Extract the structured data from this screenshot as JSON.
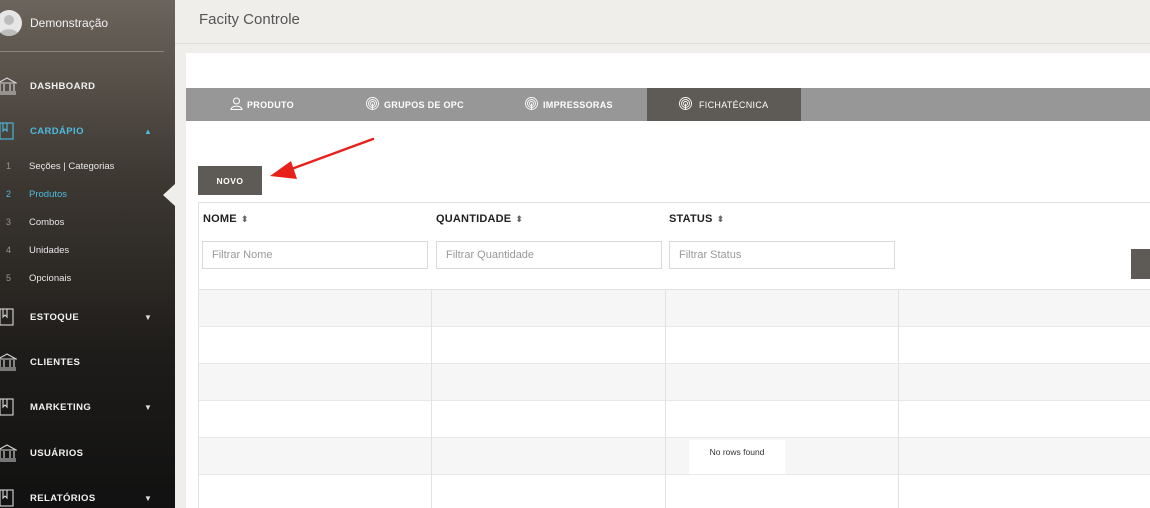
{
  "user": {
    "name": "Demonstração"
  },
  "header": {
    "title": "Facity Controle"
  },
  "sidebar": {
    "items": [
      {
        "label": "DASHBOARD",
        "icon": "bank-icon"
      },
      {
        "label": "CARDÁPIO",
        "icon": "book-icon",
        "caret": "▲"
      },
      {
        "label": "ESTOQUE",
        "icon": "book-icon",
        "caret": "▼"
      },
      {
        "label": "CLIENTES",
        "icon": "bank-icon"
      },
      {
        "label": "MARKETING",
        "icon": "book-icon",
        "caret": "▼"
      },
      {
        "label": "USUÁRIOS",
        "icon": "bank-icon"
      },
      {
        "label": "RELATÓRIOS",
        "icon": "book-icon",
        "caret": "▼"
      }
    ],
    "subitems": [
      {
        "num": "1",
        "label": "Seções | Categorias"
      },
      {
        "num": "2",
        "label": "Produtos"
      },
      {
        "num": "3",
        "label": "Combos"
      },
      {
        "num": "4",
        "label": "Unidades"
      },
      {
        "num": "5",
        "label": "Opcionais"
      }
    ]
  },
  "tabs": [
    {
      "label": "PRODUTO",
      "icon": "user-icon"
    },
    {
      "label": "GRUPOS DE OPC",
      "icon": "fingerprint-icon"
    },
    {
      "label": "IMPRESSORAS",
      "icon": "fingerprint-icon"
    },
    {
      "label": "FICHATÉCNICA",
      "icon": "fingerprint-icon"
    }
  ],
  "actions": {
    "novo": "NOVO"
  },
  "table": {
    "columns": [
      {
        "header": "NOME",
        "sort": "⬍",
        "filter_placeholder": "Filtrar Nome"
      },
      {
        "header": "QUANTIDADE",
        "sort": "⬍",
        "filter_placeholder": "Filtrar Quantidade"
      },
      {
        "header": "STATUS",
        "sort": "⬍",
        "filter_placeholder": "Filtrar Status"
      }
    ],
    "no_rows": "No rows found"
  },
  "colors": {
    "accent": "#4dbbe0",
    "tab_active": "#5e5a55",
    "tab_bar": "#979797",
    "arrow": "#e8221b"
  }
}
